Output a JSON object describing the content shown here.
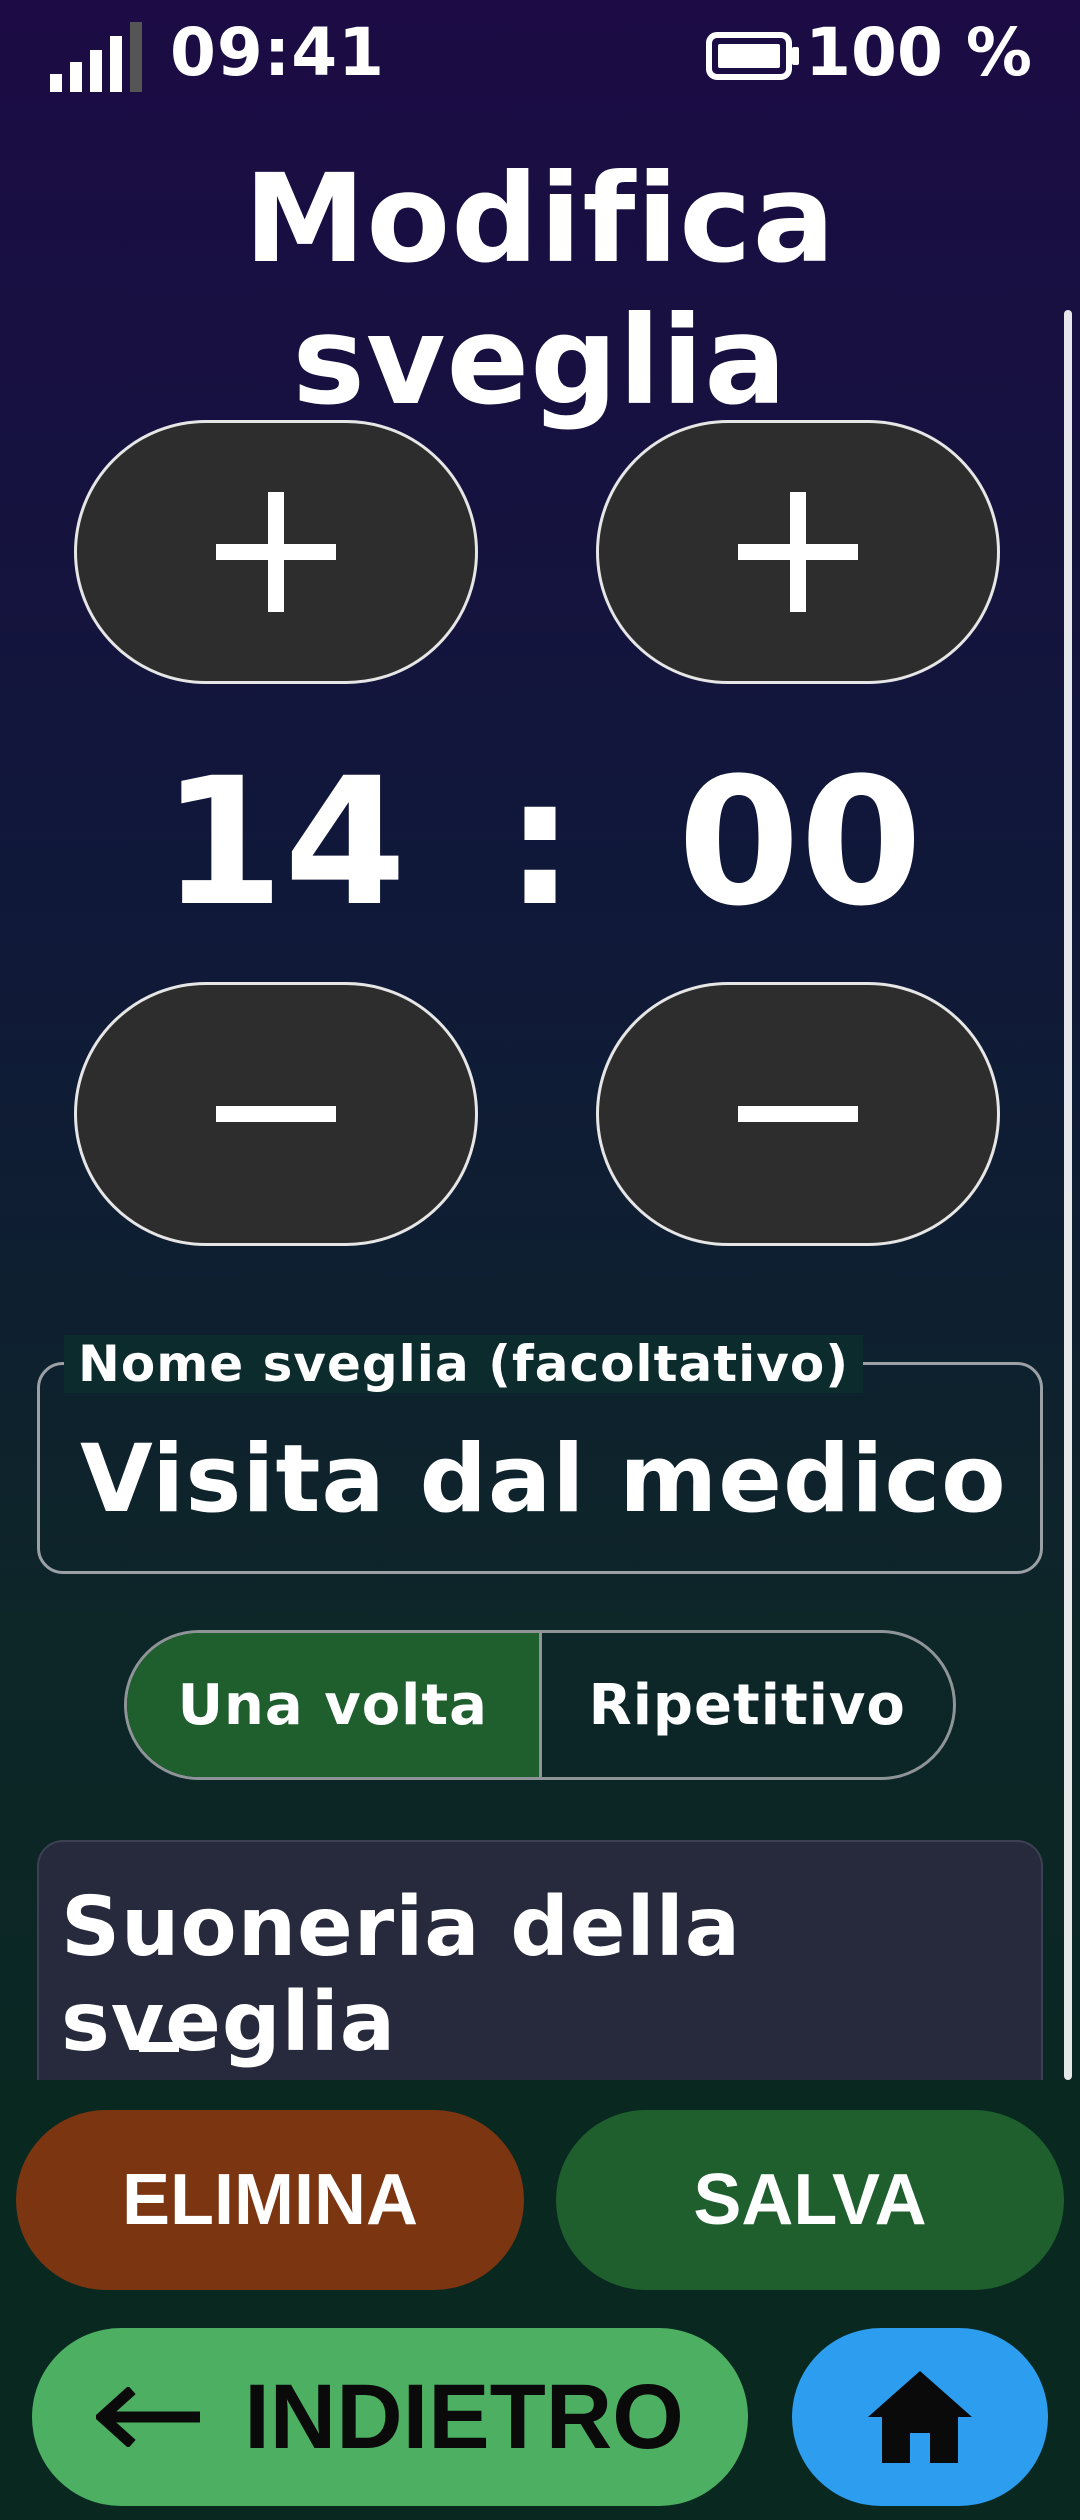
{
  "status_bar": {
    "time": "09:41",
    "battery": "100 %",
    "icons": [
      "signal-icon",
      "battery-icon"
    ]
  },
  "title": "Modifica sveglia",
  "time_picker": {
    "hours": "14",
    "separator": ":",
    "minutes": "00",
    "increment_icon": "plus-icon",
    "decrement_icon": "minus-icon"
  },
  "name_field": {
    "label": "Nome sveglia (facoltativo)",
    "value": "Visita dal medico"
  },
  "repeat_mode": {
    "options": [
      "Una volta",
      "Ripetitivo"
    ],
    "selected": "Una volta"
  },
  "ringtone": {
    "title": "Suoneria della sveglia"
  },
  "actions": {
    "delete": "ELIMINA",
    "save": "SALVA",
    "back": "INDIETRO",
    "back_icon": "arrow-left-icon",
    "home_icon": "home-icon"
  },
  "colors": {
    "delete": "#7b3511",
    "save": "#1f5f2e",
    "back": "#4caf62",
    "home": "#2d9df0",
    "selected_segment": "#1f5f2e"
  }
}
